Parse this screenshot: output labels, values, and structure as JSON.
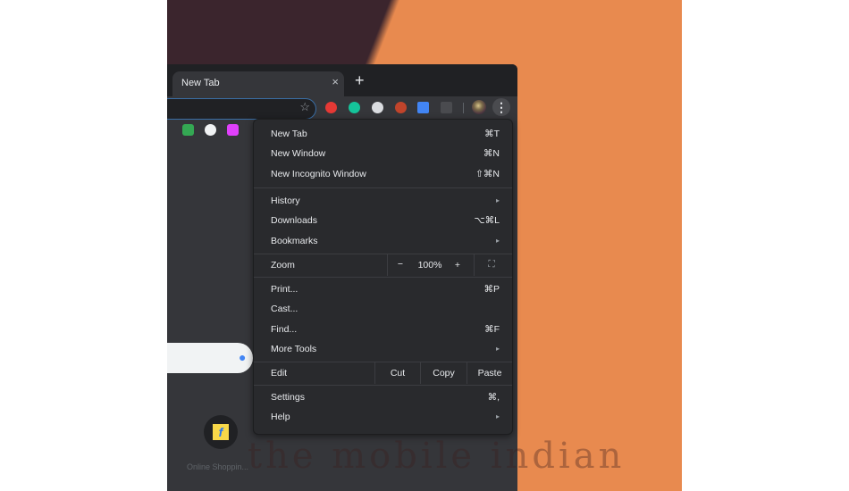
{
  "browser": {
    "tab": {
      "title": "New Tab",
      "close_glyph": "×"
    },
    "new_tab_glyph": "+",
    "star_glyph": "☆",
    "kebab_glyph": "⋮",
    "extensions": [
      {
        "name": "adblock-icon",
        "color": "#e53935"
      },
      {
        "name": "grammarly-icon",
        "color": "#15c39a"
      },
      {
        "name": "drive-icon",
        "color": "#dadce0"
      },
      {
        "name": "superman-icon",
        "color": "#c1442b"
      },
      {
        "name": "reader-icon",
        "color": "#4285f4"
      },
      {
        "name": "disabled-extension-icon",
        "color": "#4a4b4f"
      }
    ],
    "bookmarks": [
      {
        "name": "bookmark-icon-1",
        "color": "#34a853"
      },
      {
        "name": "bookmark-icon-2",
        "color": "#f1f3f4"
      },
      {
        "name": "bookmark-icon-3",
        "color": "#e040fb"
      }
    ],
    "ntp": {
      "mic_glyph": "🎤",
      "shortcut_label": "Online Shoppin...",
      "shortcut_glyph": "f"
    }
  },
  "menu": {
    "items_top": [
      {
        "label": "New Tab",
        "shortcut": "⌘T"
      },
      {
        "label": "New Window",
        "shortcut": "⌘N"
      },
      {
        "label": "New Incognito Window",
        "shortcut": "⇧⌘N"
      }
    ],
    "items_mid": [
      {
        "label": "History",
        "submenu": "▸"
      },
      {
        "label": "Downloads",
        "shortcut": "⌥⌘L"
      },
      {
        "label": "Bookmarks",
        "submenu": "▸"
      }
    ],
    "zoom": {
      "label": "Zoom",
      "minus": "−",
      "value": "100%",
      "plus": "+",
      "fullscreen": "⛶"
    },
    "items_tools": [
      {
        "label": "Print...",
        "shortcut": "⌘P"
      },
      {
        "label": "Cast..."
      },
      {
        "label": "Find...",
        "shortcut": "⌘F"
      },
      {
        "label": "More Tools",
        "submenu": "▸"
      }
    ],
    "edit": {
      "label": "Edit",
      "cut": "Cut",
      "copy": "Copy",
      "paste": "Paste"
    },
    "items_bottom": [
      {
        "label": "Settings",
        "shortcut": "⌘,"
      },
      {
        "label": "Help",
        "submenu": "▸"
      }
    ]
  },
  "watermark": "the mobile indian"
}
